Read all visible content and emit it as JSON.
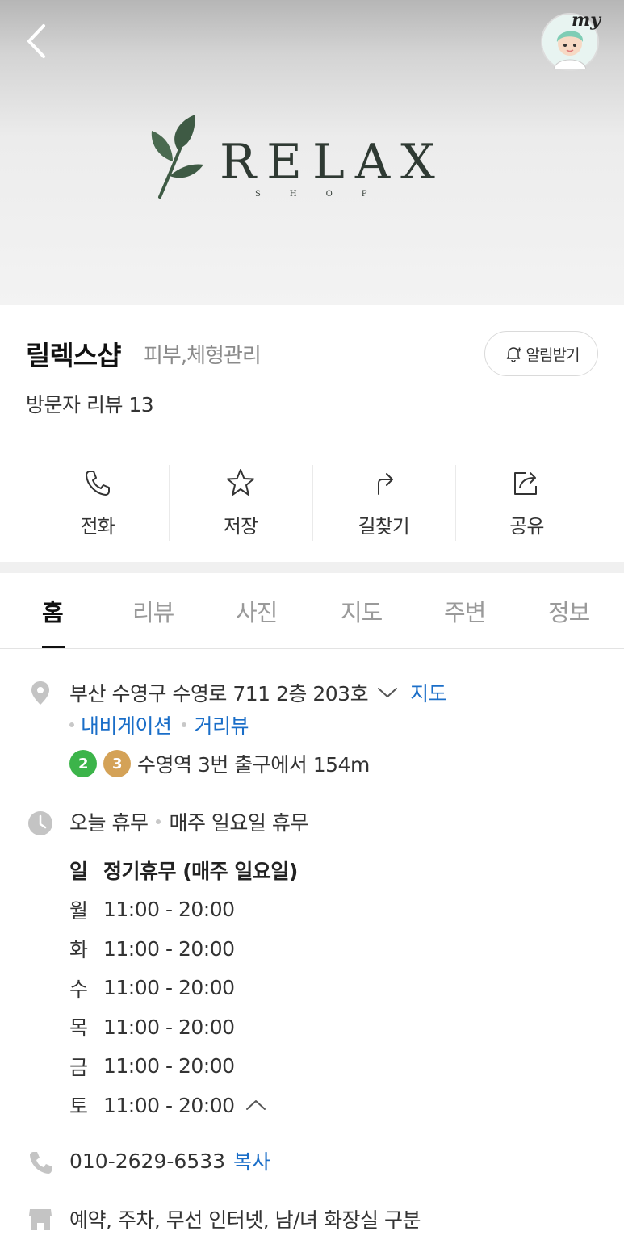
{
  "hero": {
    "logo_word": "RELAX",
    "logo_sub": "SHOP",
    "my_label": "my"
  },
  "info": {
    "name": "릴렉스샵",
    "category": "피부,체형관리",
    "alarm_label": "알림받기",
    "review": "방문자 리뷰 13",
    "actions": [
      {
        "icon": "phone-icon",
        "label": "전화"
      },
      {
        "icon": "star-icon",
        "label": "저장"
      },
      {
        "icon": "directions-icon",
        "label": "길찾기"
      },
      {
        "icon": "share-icon",
        "label": "공유"
      }
    ]
  },
  "tabs": [
    "홈",
    "리뷰",
    "사진",
    "지도",
    "주변",
    "정보"
  ],
  "active_tab": "홈",
  "address": {
    "text": "부산 수영구 수영로 711 2층 203호",
    "map_link": "지도",
    "nav_link": "내비게이션",
    "street_link": "거리뷰"
  },
  "subway": {
    "lines": [
      {
        "num": "2",
        "color": "#3cb44a"
      },
      {
        "num": "3",
        "color": "#d4a257"
      }
    ],
    "text": "수영역 3번 출구에서 154m"
  },
  "hours": {
    "status": "오늘 휴무",
    "note": "매주 일요일 휴무",
    "rows": [
      {
        "day": "일",
        "time": "정기휴무 (매주 일요일)"
      },
      {
        "day": "월",
        "time": "11:00 - 20:00"
      },
      {
        "day": "화",
        "time": "11:00 - 20:00"
      },
      {
        "day": "수",
        "time": "11:00 - 20:00"
      },
      {
        "day": "목",
        "time": "11:00 - 20:00"
      },
      {
        "day": "금",
        "time": "11:00 - 20:00"
      },
      {
        "day": "토",
        "time": "11:00 - 20:00"
      }
    ]
  },
  "phone": {
    "number": "010-2629-6533",
    "copy_label": "복사"
  },
  "amenities": "예약, 주차, 무선 인터넷, 남/녀 화장실 구분",
  "colors": {
    "link_blue": "#1a6ec8",
    "icon_gray": "#c4c4c4"
  }
}
